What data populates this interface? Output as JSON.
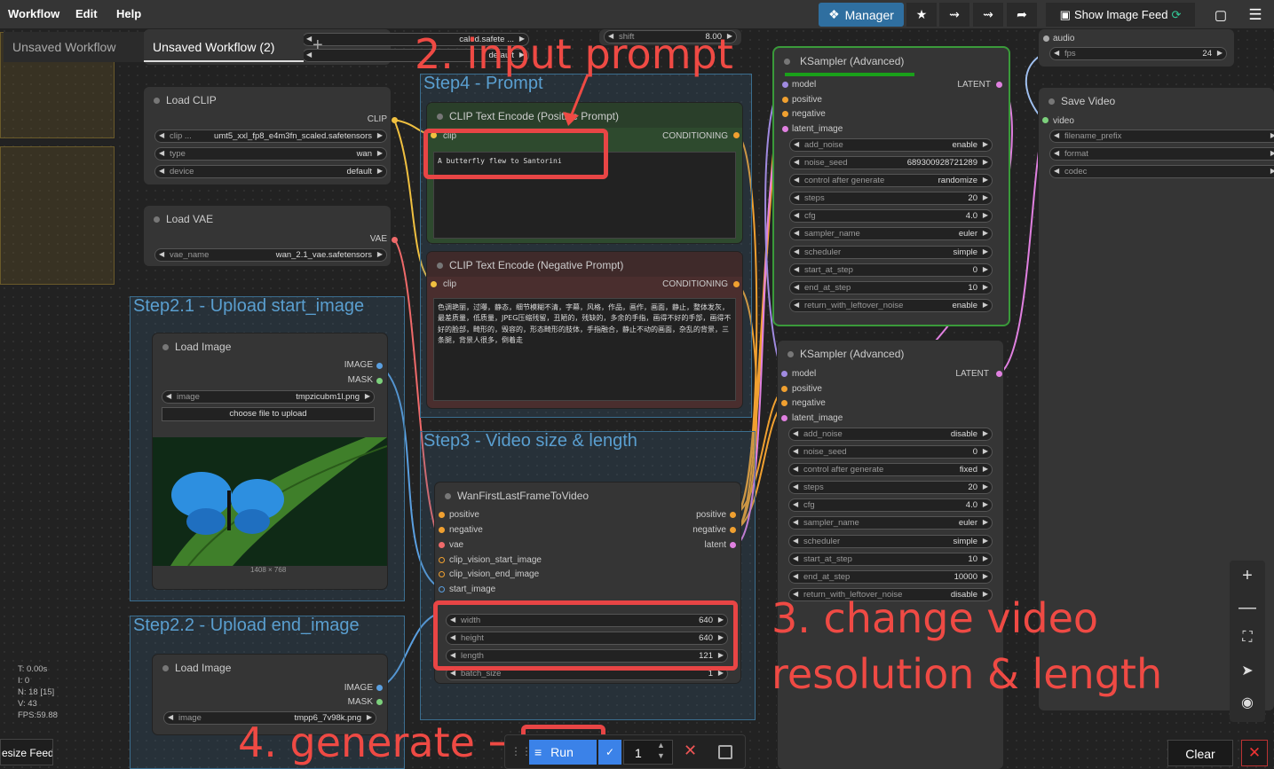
{
  "menu": {
    "workflow": "Workflow",
    "edit": "Edit",
    "help": "Help"
  },
  "toolbar": {
    "manager": "Manager",
    "show_image_feed": "Show Image Feed"
  },
  "tabs": [
    "Unsaved Workflow",
    "Unsaved Workflow (2)"
  ],
  "top_partial": {
    "ckpt_value": "caled.safete ...",
    "dtype_value": "default",
    "shift_label": "shift",
    "shift_value": "8.00",
    "audio": "audio",
    "fps_label": "fps",
    "fps_value": "24"
  },
  "groups": {
    "step4": "Step4 -  Prompt",
    "step21": "Step2.1 - Upload start_image",
    "step22": "Step2.2 - Upload end_image",
    "step3": "Step3 - Video size & length"
  },
  "load_clip": {
    "title": "Load CLIP",
    "out": "CLIP",
    "clip_label": "clip ...",
    "clip_value": "umt5_xxl_fp8_e4m3fn_scaled.safetensors",
    "type_label": "type",
    "type_value": "wan",
    "device_label": "device",
    "device_value": "default"
  },
  "load_vae": {
    "title": "Load VAE",
    "out": "VAE",
    "vae_label": "vae_name",
    "vae_value": "wan_2.1_vae.safetensors"
  },
  "load_image1": {
    "title": "Load Image",
    "out1": "IMAGE",
    "out2": "MASK",
    "image_label": "image",
    "image_value": "tmpzicubm1l.png",
    "upload": "choose file to upload",
    "size": "1408 × 768"
  },
  "load_image2": {
    "title": "Load Image",
    "out1": "IMAGE",
    "out2": "MASK",
    "image_label": "image",
    "image_value": "tmpp6_7v98k.png"
  },
  "clip_pos": {
    "title": "CLIP Text Encode (Positive Prompt)",
    "in": "clip",
    "out": "CONDITIONING",
    "text": "A butterfly flew to Santorini"
  },
  "clip_neg": {
    "title": "CLIP Text Encode (Negative Prompt)",
    "in": "clip",
    "out": "CONDITIONING",
    "text": "色调艳丽，过曝，静态，细节模糊不清，字幕，风格，作品，画作，画面，静止，整体发灰，最差质量，低质量，JPEG压缩残留，丑陋的，残缺的，多余的手指，画得不好的手部，画得不好的脸部，畸形的，毁容的，形态畸形的肢体，手指融合，静止不动的画面，杂乱的背景，三条腿，背景人很多，倒着走"
  },
  "wan": {
    "title": "WanFirstLastFrameToVideo",
    "inputs": [
      "positive",
      "negative",
      "vae",
      "clip_vision_start_image",
      "clip_vision_end_image",
      "start_image"
    ],
    "outputs": [
      "positive",
      "negative",
      "latent"
    ],
    "width_label": "width",
    "width_value": "640",
    "height_label": "height",
    "height_value": "640",
    "length_label": "length",
    "length_value": "121",
    "batch_label": "batch_size",
    "batch_value": "1"
  },
  "ks1": {
    "title": "KSampler (Advanced)",
    "inputs": [
      "model",
      "positive",
      "negative",
      "latent_image"
    ],
    "out": "LATENT",
    "widgets": [
      [
        "add_noise",
        "enable"
      ],
      [
        "noise_seed",
        "689300928721289"
      ],
      [
        "control after generate",
        "randomize"
      ],
      [
        "steps",
        "20"
      ],
      [
        "cfg",
        "4.0"
      ],
      [
        "sampler_name",
        "euler"
      ],
      [
        "scheduler",
        "simple"
      ],
      [
        "start_at_step",
        "0"
      ],
      [
        "end_at_step",
        "10"
      ],
      [
        "return_with_leftover_noise",
        "enable"
      ]
    ]
  },
  "ks2": {
    "title": "KSampler (Advanced)",
    "inputs": [
      "model",
      "positive",
      "negative",
      "latent_image"
    ],
    "out": "LATENT",
    "widgets": [
      [
        "add_noise",
        "disable"
      ],
      [
        "noise_seed",
        "0"
      ],
      [
        "control after generate",
        "fixed"
      ],
      [
        "steps",
        "20"
      ],
      [
        "cfg",
        "4.0"
      ],
      [
        "sampler_name",
        "euler"
      ],
      [
        "scheduler",
        "simple"
      ],
      [
        "start_at_step",
        "10"
      ],
      [
        "end_at_step",
        "10000"
      ],
      [
        "return_with_leftover_noise",
        "disable"
      ]
    ]
  },
  "save_video": {
    "title": "Save Video",
    "in": "video",
    "w1": "filename_prefix",
    "w2": "format",
    "w3": "codec"
  },
  "annotations": {
    "a2": "2. input prompt",
    "a3_line1": "3. change video",
    "a3_line2": "resolution & length",
    "a4": "4. generate →"
  },
  "stats": [
    "T: 0.00s",
    "I: 0",
    "N: 18 [15]",
    "V: 43",
    "FPS:59.88"
  ],
  "bottom": {
    "resize_feed": "esize Feed",
    "run": "Run",
    "batch_count": "1",
    "clear": "Clear"
  },
  "colors": {
    "accent": "#2f6fa0",
    "annotation": "#ef4a44",
    "group_title": "#5a9fd0"
  }
}
